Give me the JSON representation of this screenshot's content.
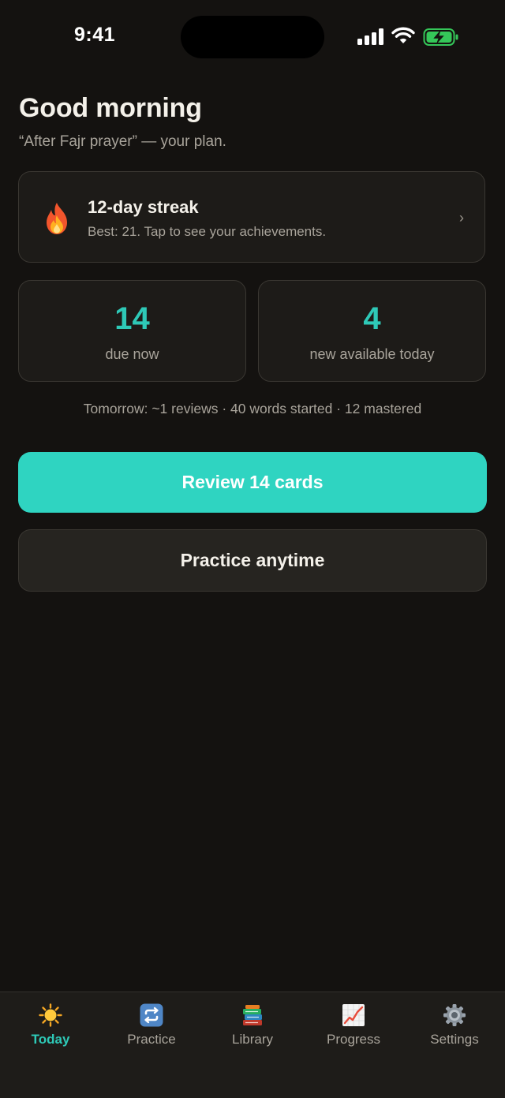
{
  "status_bar": {
    "time": "9:41"
  },
  "header": {
    "greeting": "Good morning",
    "plan": "“After Fajr prayer” — your plan."
  },
  "streak": {
    "title": "12-day streak",
    "subtitle": "Best: 21. Tap to see your achievements.",
    "chevron": "›",
    "icon": "flame-icon"
  },
  "stats": {
    "due": {
      "value": "14",
      "label": "due now"
    },
    "new": {
      "value": "4",
      "label": "new available today"
    }
  },
  "summary": "Tomorrow: ~1 reviews · 40 words started · 12 mastered",
  "actions": {
    "review_label": "Review 14 cards",
    "practice_label": "Practice anytime"
  },
  "tabs": [
    {
      "label": "Today",
      "icon": "sun-icon",
      "active": true
    },
    {
      "label": "Practice",
      "icon": "repeat-icon",
      "active": false
    },
    {
      "label": "Library",
      "icon": "books-icon",
      "active": false
    },
    {
      "label": "Progress",
      "icon": "chart-icon",
      "active": false
    },
    {
      "label": "Settings",
      "icon": "gear-icon",
      "active": false
    }
  ],
  "colors": {
    "background": "#141210",
    "accent": "#2fd4c1",
    "card": "#1d1b18",
    "muted_text": "#a9a49b"
  }
}
